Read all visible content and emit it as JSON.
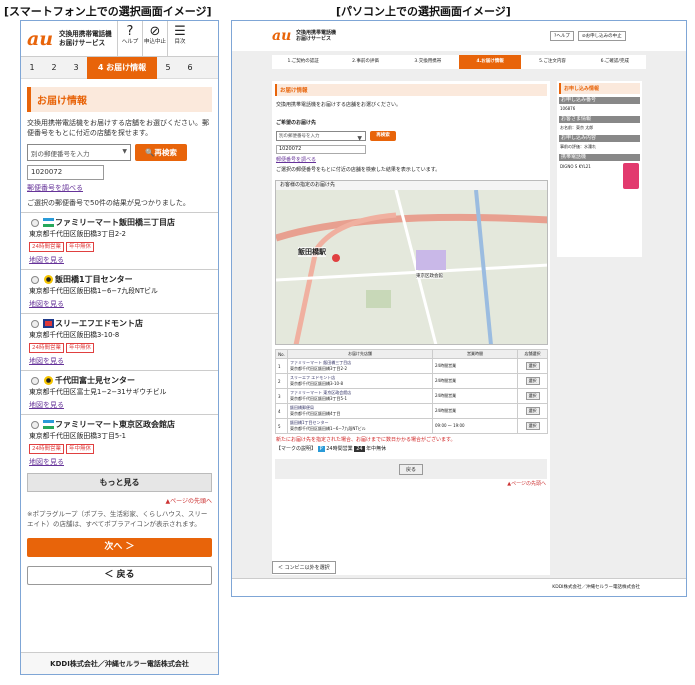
{
  "captions": {
    "sp": "[スマートフォン上での選択画面イメージ]",
    "pc": "[パソコン上での選択画面イメージ]"
  },
  "brand": {
    "logo": "au",
    "title1": "交換用携帯電話機",
    "title2": "お届けサービス",
    "accent": "#e8640a"
  },
  "sp": {
    "icons": [
      {
        "name": "help-icon",
        "glyph": "?",
        "label": "ヘルプ"
      },
      {
        "name": "cancel-icon",
        "glyph": "⊘",
        "label": "申込中止"
      },
      {
        "name": "menu-icon",
        "glyph": "☰",
        "label": "目次"
      }
    ],
    "steps": [
      "1",
      "2",
      "3",
      "4 お届け情報",
      "5",
      "6"
    ],
    "section": "お届け情報",
    "intro": "交換用携帯電話機をお届けする店舗をお選びください。郵便番号をもとに付近の店舗を探せます。",
    "select": "別の郵便番号を入力",
    "research": "再検索",
    "postal": "1020072",
    "postal_link": "郵便番号を調べる",
    "result": "ご選択の郵便番号で50件の結果が見つかりました。",
    "stores": [
      {
        "name": "ファミリーマート飯田橋三丁目店",
        "addr": "東京都千代田区飯田橋3丁目2-2",
        "badges": [
          "24時間営業",
          "年中無休"
        ],
        "map": "地図を見る"
      },
      {
        "name": "飯田橋1丁目センター",
        "addr": "東京都千代田区飯田橋1−6−7九段NTビル",
        "badges": [],
        "map": "地図を見る"
      },
      {
        "name": "スリーエフエドモント店",
        "addr": "東京都千代田区飯田橋3-10-8",
        "badges": [
          "24時間営業",
          "年中無休"
        ],
        "map": "地図を見る"
      },
      {
        "name": "千代田富士見センター",
        "addr": "東京都千代田区富士見1−2−31サギウチビル",
        "badges": [],
        "map": "地図を見る"
      },
      {
        "name": "ファミリーマート東京区政会館店",
        "addr": "東京都千代田区飯田橋3丁目5-1",
        "badges": [
          "24時間営業",
          "年中無休"
        ],
        "map": "地図を見る"
      }
    ],
    "more": "もっと見る",
    "pagetop": "▲ページの先頭へ",
    "note": "※ポプラグループ（ポプラ、生活彩家、くらしハウス、スリーエイト）の店舗は、すべてポプラアイコンが表示されます。",
    "next": "次へ ＞",
    "back": "＜ 戻る",
    "footer": "KDDI株式会社／沖縄セルラー電話株式会社"
  },
  "pc": {
    "help": "ヘルプ",
    "cancel": "お申し込みの中止",
    "steps": [
      "1.ご契約の認証",
      "2.事前の評価",
      "3.交換用携帯",
      "4.お届け情報",
      "5.ご注文内容",
      "6.ご確認/完成"
    ],
    "section": "お届け情報",
    "intro": "交換用携帯電話機をお届けする店舗をお選びください。",
    "sub": "ご希望のお届け先",
    "select": "別の郵便番号を入力",
    "research": "再検索",
    "postal": "1020072",
    "postal_link": "郵便番号を調べる",
    "result": "ご選択の郵便番号をもとに付近の店舗を検索した結果を表示しています。",
    "map_title": "お客様の指定のお届け先",
    "map_labels": [
      "飯田橋駅",
      "東京区政会館"
    ],
    "table_head": [
      "No.",
      "お届け先店舗",
      "営業時間",
      "店舗選択"
    ],
    "rows": [
      {
        "no": "1",
        "store": "ファミリーマート 飯田橋三丁目店",
        "addr": "東京都千代田区飯田橋3丁目2-2",
        "hours": "24時間営業",
        "sel": "選択"
      },
      {
        "no": "2",
        "store": "スリーエフ エドモント店",
        "addr": "東京都千代田区飯田橋3-10-8",
        "hours": "24時間営業",
        "sel": "選択"
      },
      {
        "no": "3",
        "store": "ファミリーマート 東京区政会館店",
        "addr": "東京都千代田区飯田橋3丁目5-1",
        "hours": "24時間営業",
        "sel": "選択"
      },
      {
        "no": "4",
        "store": "飯田橋郵便局",
        "addr": "東京都千代田区飯田橋4丁目",
        "hours": "24時間営業",
        "sel": "選択"
      },
      {
        "no": "5",
        "store": "飯田橋1丁目センター",
        "addr": "東京都千代田区飯田橋1−6−7九段NTビル",
        "hours": "09:00 〜 19:00",
        "sel": "選択"
      }
    ],
    "warn": "新たにお届け先を指定された場合、お届けまでに数日かかる場合がございます。",
    "legend": "【マークの説明】",
    "legend1": "24時間営業",
    "legend2": "年中無休",
    "return": "戻る",
    "pagetop": "▲ページの先頭へ",
    "conv": "＜ コンビニ以外を選択",
    "side": {
      "title": "お申し込み情報",
      "h1": "お申し込み番号",
      "v1": "106876",
      "h2": "お客さま情報",
      "v2": "お名前：東京 太郎",
      "h3": "お申し込み内容",
      "v3": "事前の評価：水濡れ",
      "h4": "携帯電話機",
      "v4": "DIGNO S KYL21"
    },
    "footer": "KDDI株式会社／沖縄セルラー電話株式会社"
  }
}
